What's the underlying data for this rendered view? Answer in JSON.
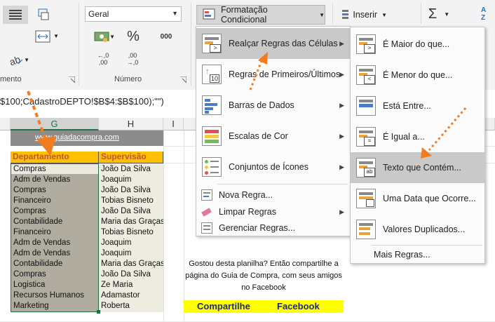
{
  "ribbon": {
    "number_format": "Geral",
    "groups": {
      "alignment_label": "mento",
      "number_label": "Número"
    },
    "number_buttons": {
      "percent": "%",
      "comma": "000",
      "inc_decimal_top": "←,0",
      "inc_decimal_bottom": ",00",
      "dec_decimal_top": ",00",
      "dec_decimal_bottom": "→,0"
    },
    "conditional_formatting_label": "Formatação Condicional",
    "insert_label": "Inserir",
    "sum_symbol": "Σ",
    "sort_label": "A Z"
  },
  "formula_bar": {
    "text": "$100;CadastroDEPTO!$B$4:$B$100);\"\")"
  },
  "columns": {
    "g": "G",
    "h": "H",
    "i": "I"
  },
  "sheet": {
    "link": "www.guiadacompra.com",
    "headers": {
      "departamento": "Departamento",
      "supervisao": "Supervisão"
    },
    "rows": [
      {
        "dept": "Compras",
        "sup": "João Da Silva"
      },
      {
        "dept": "Adm de Vendas",
        "sup": "Joaquim"
      },
      {
        "dept": "Compras",
        "sup": "João Da Silva"
      },
      {
        "dept": "Financeiro",
        "sup": "Tobias Bisneto"
      },
      {
        "dept": "Compras",
        "sup": "João Da Silva"
      },
      {
        "dept": "Contabilidade",
        "sup": "Maria das Graças"
      },
      {
        "dept": "Financeiro",
        "sup": "Tobias Bisneto"
      },
      {
        "dept": "Adm de Vendas",
        "sup": "Joaquim"
      },
      {
        "dept": "Adm de Vendas",
        "sup": "Joaquim"
      },
      {
        "dept": "Contabilidade",
        "sup": "Maria das Graças"
      },
      {
        "dept": "Compras",
        "sup": "João Da Silva"
      },
      {
        "dept": "Logistica",
        "sup": "Ze Maria"
      },
      {
        "dept": "Recursos Humanos",
        "sup": "Adamastor"
      },
      {
        "dept": "Marketing",
        "sup": "Roberta"
      }
    ]
  },
  "promo": {
    "line1": "Gostou desta planilha? Então compartilhe a",
    "line2": "página do Guia de Compra, com seus amigos",
    "line3": "no Facebook",
    "share_label": "Compartilhe",
    "facebook_label": "Facebook"
  },
  "menu_cf": {
    "items": [
      {
        "label": "Realçar Regras das Células"
      },
      {
        "label": "Regras de Primeiros/Últimos"
      },
      {
        "label": "Barras de Dados"
      },
      {
        "label": "Escalas de Cor"
      },
      {
        "label": "Conjuntos de Ícones"
      }
    ],
    "small_items": [
      {
        "label": "Nova Regra..."
      },
      {
        "label": "Limpar Regras"
      },
      {
        "label": "Gerenciar Regras..."
      }
    ],
    "icon_texts": {
      "top10": "10"
    }
  },
  "menu_highlight": {
    "items": [
      {
        "label": "É Maior do que..."
      },
      {
        "label": "É Menor do que..."
      },
      {
        "label": "Está Entre..."
      },
      {
        "label": "É Igual a..."
      },
      {
        "label": "Texto que Contém..."
      },
      {
        "label": "Uma Data que Ocorre..."
      },
      {
        "label": "Valores Duplicados..."
      }
    ],
    "more_rules": "Mais Regras...",
    "icon_texts": {
      "greater": ">",
      "less": "<",
      "equal": "=",
      "text": "ab"
    }
  },
  "colors": {
    "header_fill": "#ffc000",
    "header_text": "#c0504d",
    "selection_fill": "#b0aca0",
    "supervisao_fill": "#eeece1",
    "arrow": "#f47c20",
    "link_bg": "#8c8c8c"
  }
}
